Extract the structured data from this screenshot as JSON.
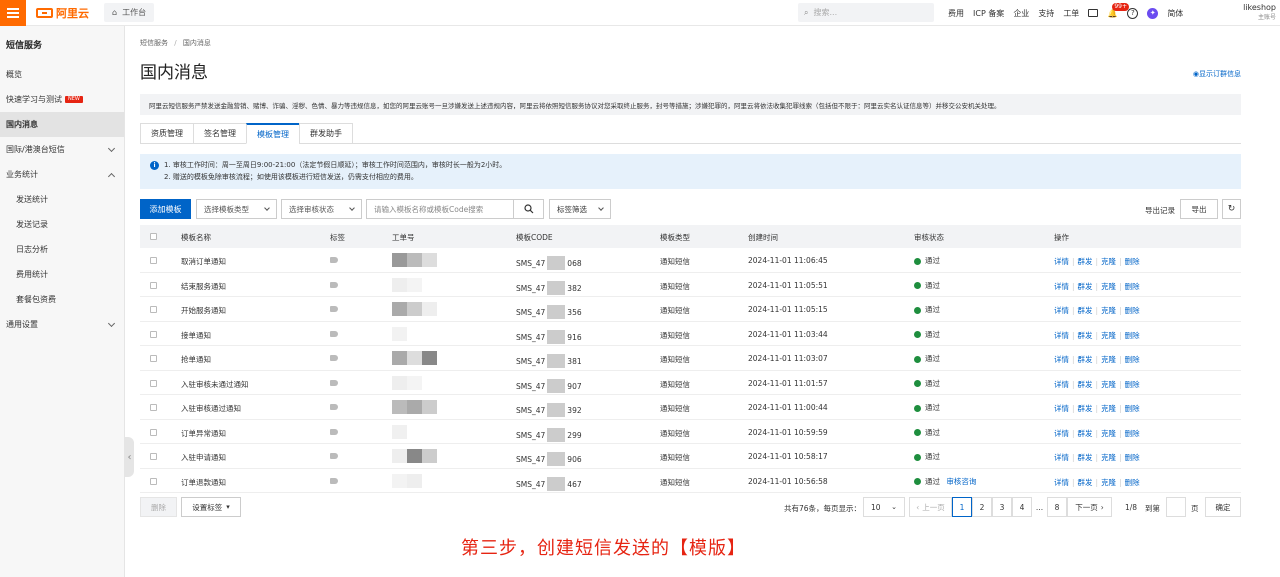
{
  "topbar": {
    "logo": "阿里云",
    "workspace": "工作台",
    "search_placeholder": "搜索...",
    "links": [
      "费用",
      "ICP 备案",
      "企业",
      "支持",
      "工单"
    ],
    "notif_badge": "99+",
    "lang": "简体",
    "user_name": "likeshop",
    "user_role": "主账号"
  },
  "sidebar": {
    "title": "短信服务",
    "items": [
      {
        "label": "概览"
      },
      {
        "label": "快速学习与测试",
        "tag": "NEW"
      },
      {
        "label": "国内消息"
      },
      {
        "label": "国际/港澳台短信"
      },
      {
        "label": "业务统计"
      },
      {
        "label": "发送统计"
      },
      {
        "label": "发送记录"
      },
      {
        "label": "日志分析"
      },
      {
        "label": "费用统计"
      },
      {
        "label": "套餐包资费"
      },
      {
        "label": "通用设置"
      }
    ]
  },
  "main": {
    "breadcrumb": [
      "短信服务",
      "/",
      "国内消息"
    ],
    "title": "国内消息",
    "show_sub": "显示订群信息",
    "notice": "阿里云短信服务严禁发送金融营销、赌博、诈骗、淫秽、色情、暴力等违规信息，如您的阿里云账号一旦涉嫌发送上述违规内容，阿里云将依照短信服务协议对您采取终止服务，封号等措施；涉嫌犯罪的，阿里云将依法收集犯罪线索（包括但不限于：阿里云实名认证信息等）并移交公安机关处理。",
    "tabs": [
      "资质管理",
      "签名管理",
      "模板管理",
      "群发助手"
    ],
    "info": [
      "1. 审核工作时间：周一至周日9:00-21:00（法定节假日顺延）；审核工作时间范围内，审核时长一般为2小时。",
      "2. 赠送的模板免除审核流程；如使用该模板进行短信发送，仍需支付相应的费用。"
    ],
    "toolbar": {
      "add": "添加模板",
      "type_select": "选择模板类型",
      "status_select": "选择审核状态",
      "search_placeholder": "请输入模板名称或模板Code搜索",
      "tag_filter": "标签筛选",
      "export_records": "导出记录",
      "export": "导出"
    },
    "columns": [
      "模板名称",
      "标签",
      "工单号",
      "模板CODE",
      "模板类型",
      "创建时间",
      "审核状态",
      "操作"
    ],
    "rows": [
      {
        "name": "取消订单通知",
        "code_a": "SMS_47",
        "code_b": "068",
        "type": "通知短信",
        "time": "2024-11-01 11:06:45",
        "status": "通过",
        "extra": ""
      },
      {
        "name": "结束服务通知",
        "code_a": "SMS_47",
        "code_b": "382",
        "type": "通知短信",
        "time": "2024-11-01 11:05:51",
        "status": "通过",
        "extra": ""
      },
      {
        "name": "开始服务通知",
        "code_a": "SMS_47",
        "code_b": "356",
        "type": "通知短信",
        "time": "2024-11-01 11:05:15",
        "status": "通过",
        "extra": ""
      },
      {
        "name": "接单通知",
        "code_a": "SMS_47",
        "code_b": "916",
        "type": "通知短信",
        "time": "2024-11-01 11:03:44",
        "status": "通过",
        "extra": ""
      },
      {
        "name": "抢单通知",
        "code_a": "SMS_47",
        "code_b": "381",
        "type": "通知短信",
        "time": "2024-11-01 11:03:07",
        "status": "通过",
        "extra": ""
      },
      {
        "name": "入驻审核未通过通知",
        "code_a": "SMS_47",
        "code_b": "907",
        "type": "通知短信",
        "time": "2024-11-01 11:01:57",
        "status": "通过",
        "extra": ""
      },
      {
        "name": "入驻审核通过通知",
        "code_a": "SMS_47",
        "code_b": "392",
        "type": "通知短信",
        "time": "2024-11-01 11:00:44",
        "status": "通过",
        "extra": ""
      },
      {
        "name": "订单异常通知",
        "code_a": "SMS_47",
        "code_b": "299",
        "type": "通知短信",
        "time": "2024-11-01 10:59:59",
        "status": "通过",
        "extra": ""
      },
      {
        "name": "入驻申请通知",
        "code_a": "SMS_47",
        "code_b": "906",
        "type": "通知短信",
        "time": "2024-11-01 10:58:17",
        "status": "通过",
        "extra": ""
      },
      {
        "name": "订单退款通知",
        "code_a": "SMS_47",
        "code_b": "467",
        "type": "通知短信",
        "time": "2024-11-01 10:56:58",
        "status": "通过",
        "extra": "审核咨询"
      }
    ],
    "actions": [
      "详情",
      "群发",
      "克隆",
      "删除"
    ],
    "footer": {
      "delete": "删除",
      "set_tag": "设置标签",
      "total": "共有76条，每页显示：",
      "page_size": "10",
      "prev": "上一页",
      "pages": [
        "1",
        "2",
        "3",
        "4",
        "...",
        "8"
      ],
      "next": "下一页",
      "page_info": "1/8",
      "goto": "到第",
      "page_unit": "页",
      "confirm": "确定"
    }
  },
  "caption": "第三步，创建短信发送的【模版】",
  "colors": {
    "brand": "#ff6a00",
    "primary": "#0064c8",
    "success": "#1e8e3e",
    "caption": "#e62412"
  }
}
